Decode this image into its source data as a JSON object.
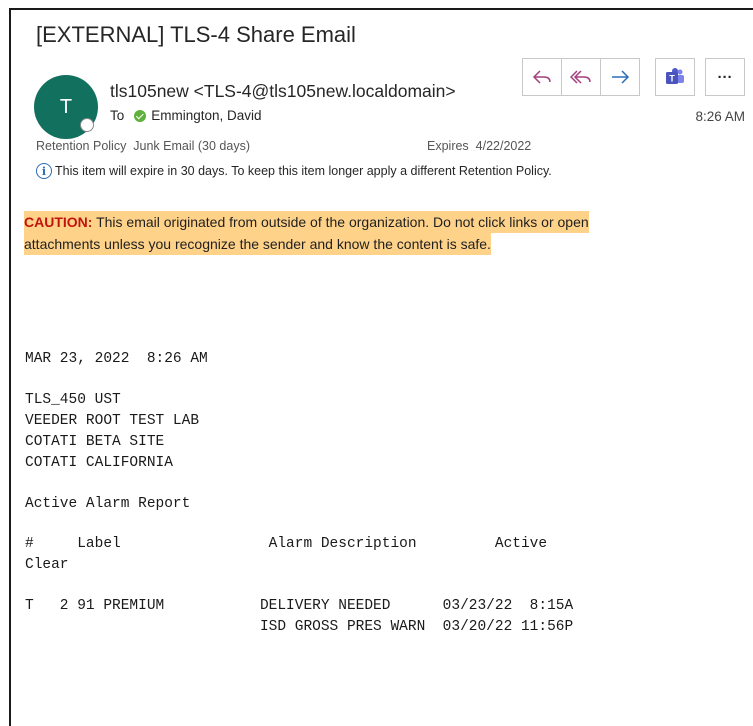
{
  "email": {
    "subject": "[EXTERNAL] TLS-4 Share Email",
    "avatar_initial": "T",
    "sender": "tls105new <TLS-4@tls105new.localdomain>",
    "to_prefix": "To",
    "recipient": "Emmington, David",
    "time": "8:26 AM",
    "retention_label": "Retention Policy",
    "retention_value": "Junk Email (30 days)",
    "expires_label": "Expires",
    "expires_value": "4/22/2022",
    "info_icon_text": "i",
    "info_text": "This item will expire in 30 days. To keep this item longer apply a different Retention Policy."
  },
  "toolbar": {
    "reply_icon": "reply-icon",
    "reply_all_icon": "reply-all-icon",
    "forward_icon": "forward-icon",
    "teams_icon": "teams-icon",
    "more_icon": "more-icon",
    "teams_glyph": "T",
    "more_glyph": "···",
    "accent_color": "#a33f7f",
    "teams_color": "#4b53bc"
  },
  "caution": {
    "label": "CAUTION:",
    "line1": " This email originated from outside of the organization. Do not click links or open",
    "line2": "attachments unless you recognize the sender and know the content is safe.",
    "highlight_color": "#ffd28a"
  },
  "report": {
    "timestamp": "MAR 23, 2022  8:26 AM",
    "header_lines": [
      "TLS_450 UST",
      "VEEDER ROOT TEST LAB",
      "COTATI BETA SITE",
      "COTATI CALIFORNIA"
    ],
    "title": "Active Alarm Report",
    "columns_line": "#     Label                 Alarm Description         Active",
    "columns_wrap": "Clear",
    "rows": [
      "T   2 91 PREMIUM           DELIVERY NEEDED      03/23/22  8:15A",
      "                           ISD GROSS PRES WARN  03/20/22 11:56P"
    ]
  }
}
